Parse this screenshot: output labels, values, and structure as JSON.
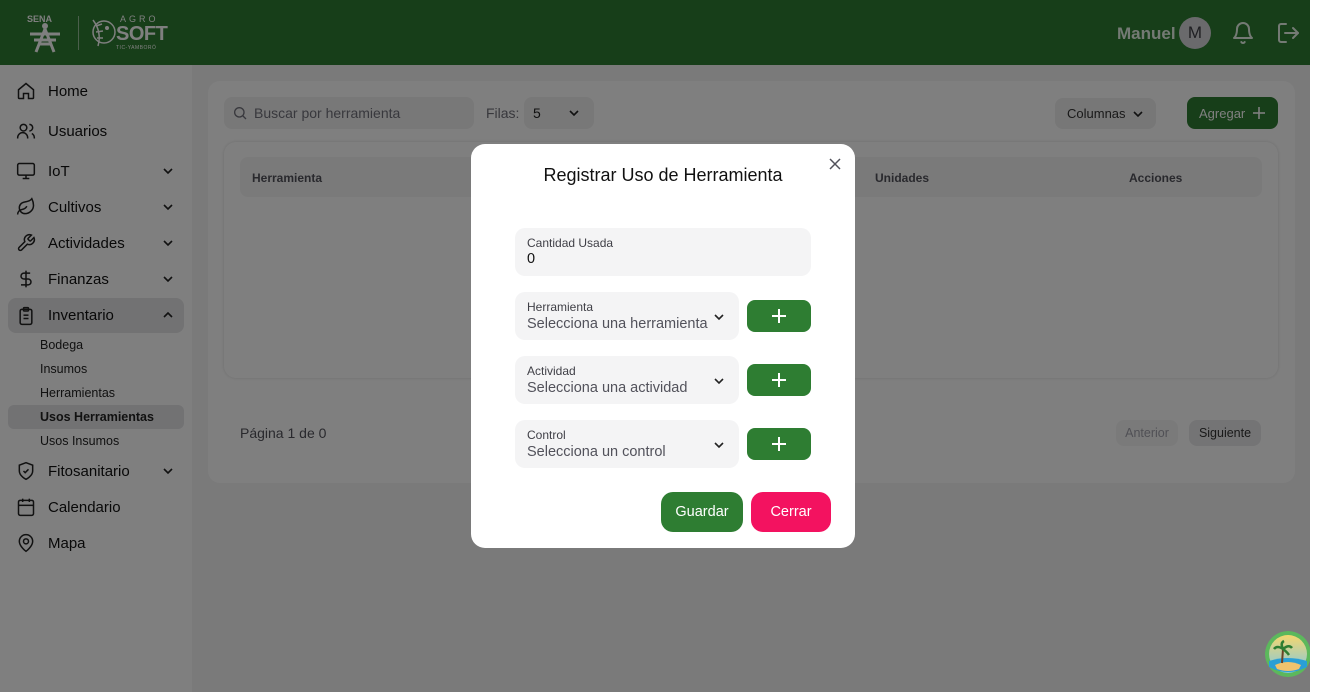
{
  "header": {
    "logo_sena": "SENA",
    "logo_agro_top": "AGRO",
    "logo_agro_main": "SOFT",
    "logo_agro_sub": "TIC-YAMBORÓ",
    "user_name": "Manuel",
    "avatar_initial": "M",
    "icons": [
      "bell-icon",
      "logout-icon"
    ]
  },
  "sidebar": {
    "items": [
      {
        "label": "Home",
        "icon": "home-icon"
      },
      {
        "label": "Usuarios",
        "icon": "users-icon"
      },
      {
        "label": "IoT",
        "icon": "monitor-icon"
      },
      {
        "label": "Cultivos",
        "icon": "leaf-icon"
      },
      {
        "label": "Actividades",
        "icon": "wrench-icon"
      },
      {
        "label": "Finanzas",
        "icon": "dollar-icon"
      },
      {
        "label": "Inventario",
        "icon": "clipboard-icon"
      },
      {
        "label": "Fitosanitario",
        "icon": "shield-icon"
      },
      {
        "label": "Calendario",
        "icon": "calendar-icon"
      },
      {
        "label": "Mapa",
        "icon": "map-pin-icon"
      }
    ],
    "inventario_sub": [
      "Bodega",
      "Insumos",
      "Herramientas",
      "Usos Herramientas",
      "Usos Insumos"
    ],
    "active_sub": "Usos Herramientas"
  },
  "toolbar": {
    "search_placeholder": "Buscar por herramienta",
    "rows_label": "Filas:",
    "rows_value": "5",
    "columns_label": "Columnas",
    "add_label": "Agregar"
  },
  "table": {
    "headers": [
      "Herramienta",
      "Unidades",
      "Acciones"
    ]
  },
  "pagination": {
    "info": "Página 1 de 0",
    "prev": "Anterior",
    "next": "Siguiente"
  },
  "modal": {
    "title": "Registrar Uso de Herramienta",
    "quantity_label": "Cantidad Usada",
    "quantity_value": "0",
    "tool_label": "Herramienta",
    "tool_placeholder": "Selecciona una herramienta",
    "activity_label": "Actividad",
    "activity_placeholder": "Selecciona una actividad",
    "control_label": "Control",
    "control_placeholder": "Selecciona un control",
    "save_label": "Guardar",
    "close_label": "Cerrar"
  },
  "colors": {
    "primary": "#2e7d32",
    "danger": "#f31260",
    "overlay": "rgba(0,0,0,0.5)"
  }
}
